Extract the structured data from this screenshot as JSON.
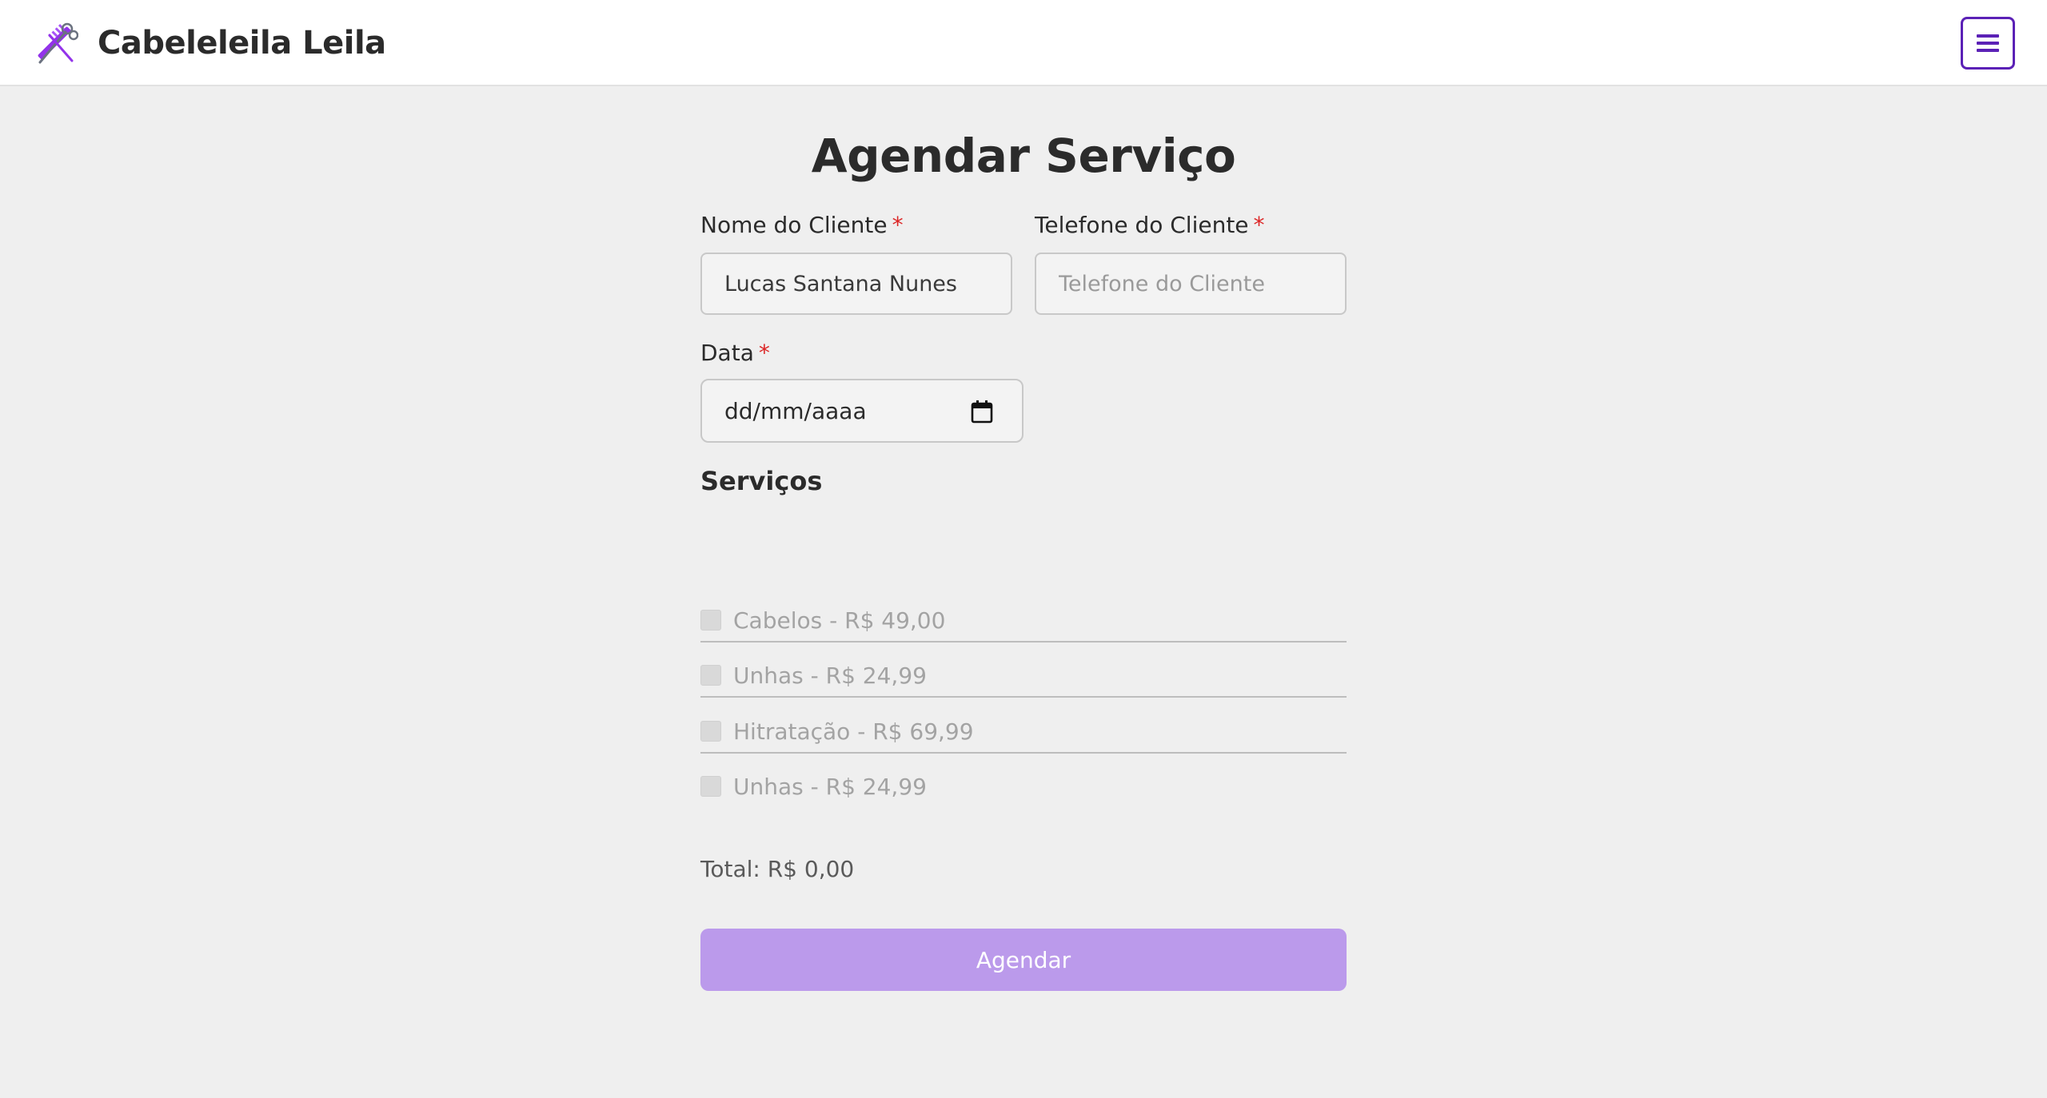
{
  "header": {
    "brand_title": "Cabeleleila Leila",
    "brand_icon": "scissors-comb-icon",
    "menu_icon": "hamburger-menu-icon"
  },
  "form": {
    "title": "Agendar Serviço",
    "required_marker": "*",
    "name_label": "Nome do Cliente",
    "name_value": "Lucas Santana Nunes",
    "phone_label": "Telefone do Cliente",
    "phone_placeholder": "Telefone do Cliente",
    "date_label": "Data",
    "date_value": "dd/mm/aaaa",
    "date_icon": "calendar-icon",
    "services_title": "Serviços",
    "services": [
      {
        "label": "Cabelos - R$ 49,00",
        "checked": false
      },
      {
        "label": "Unhas - R$ 24,99",
        "checked": false
      },
      {
        "label": "Hitratação - R$ 69,99",
        "checked": false
      },
      {
        "label": "Unhas - R$ 24,99",
        "checked": false
      }
    ],
    "total": "Total: R$ 0,00",
    "submit_label": "Agendar"
  },
  "colors": {
    "accent": "#5b21b6",
    "brand_purple": "#9333ea",
    "button_bg": "#bb9aeb",
    "required": "#dc2626",
    "page_bg": "#efefef"
  }
}
